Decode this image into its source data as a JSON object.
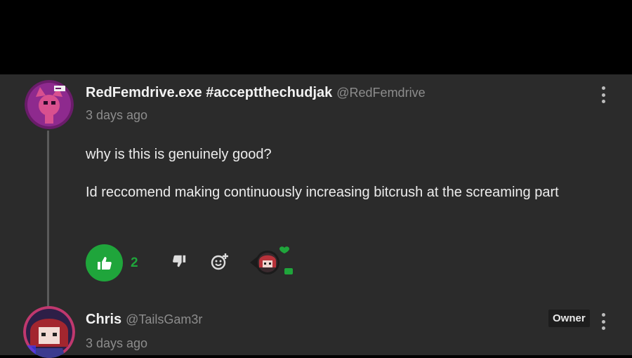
{
  "comments": [
    {
      "author": "RedFemdrive.exe #acceptthechudjak",
      "handle": "@RedFemdrive",
      "timestamp": "3 days ago",
      "body": [
        "why is this is genuinely good?",
        "Id reccomend making continuously increasing bitcrush at the screaming part"
      ],
      "likes": "2",
      "avatar_icon": "pink-masked-character-avatar"
    },
    {
      "author": "Chris",
      "handle": "@TailsGam3r",
      "timestamp": "3 days ago",
      "badge": "Owner",
      "avatar_icon": "red-haired-anime-avatar"
    }
  ],
  "icons": {
    "like": "thumbs-up-icon",
    "dislike": "thumbs-down-icon",
    "react": "add-reaction-icon",
    "more": "vertical-dots-icon"
  },
  "colors": {
    "background": "#2b2b2b",
    "accent_green": "#1fa53b",
    "text_primary": "#f2f2f2",
    "text_secondary": "#8d8d8d"
  }
}
